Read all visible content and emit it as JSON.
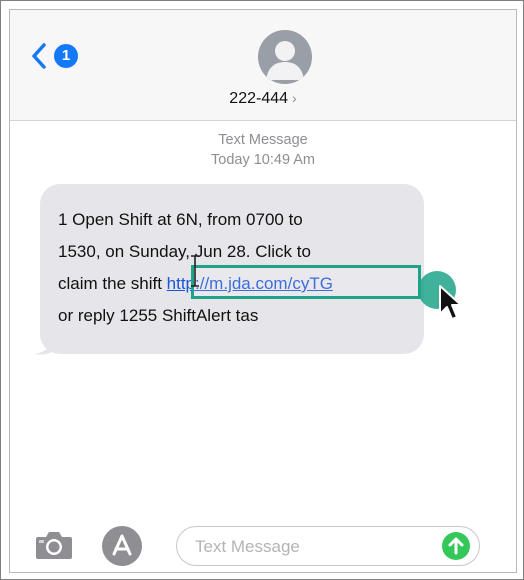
{
  "header": {
    "back_badge": "1",
    "contact_name": "222-444",
    "contact_arrow": "›"
  },
  "thread": {
    "label": "Text Message",
    "timestamp": "Today 10:49 Am",
    "message": {
      "line1": "1 Open Shift at 6N, from 0700 to",
      "line2": "1530, on Sunday, Jun 28. Click to",
      "line3_prefix": "claim the shift ",
      "link": "http://m.jda.com/cyTG",
      "line4": "or reply 1255 ShiftAlert tas"
    }
  },
  "composer": {
    "placeholder": "Text Message",
    "value": ""
  },
  "colors": {
    "accent_blue": "#1479f6",
    "highlight_teal": "#1fa388",
    "send_green": "#34c759",
    "bubble_gray": "#e5e5ea"
  },
  "icons": [
    "chevron-left-icon",
    "avatar-icon",
    "camera-icon",
    "app-store-icon",
    "send-arrow-icon",
    "mouse-cursor-icon",
    "text-cursor-icon"
  ]
}
